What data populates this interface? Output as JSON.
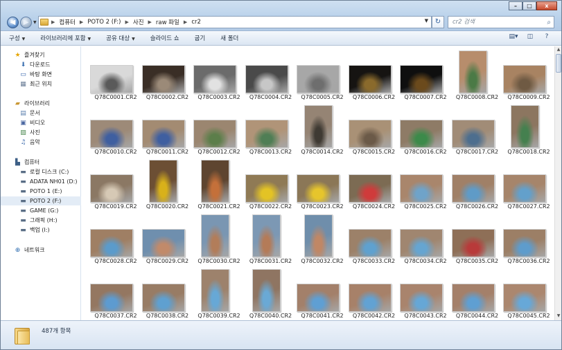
{
  "window": {
    "address_crumbs": [
      "컴퓨터",
      "POTO 2 (F:)",
      "사진",
      "raw 파일",
      "cr2"
    ],
    "search_placeholder": "cr2 검색",
    "min_label": "–",
    "max_label": "□",
    "close_label": "x"
  },
  "toolbar": {
    "items": [
      {
        "label": "구성",
        "dropdown": true
      },
      {
        "label": "라이브러리에 포함",
        "dropdown": true
      },
      {
        "label": "공유 대상",
        "dropdown": true
      },
      {
        "label": "슬라이드 쇼",
        "dropdown": false
      },
      {
        "label": "굽기",
        "dropdown": false
      },
      {
        "label": "새 폴더",
        "dropdown": false
      }
    ]
  },
  "sidebar": {
    "favorites_header": "즐겨찾기",
    "favorites": [
      "다운로드",
      "바탕 화면",
      "최근 위치"
    ],
    "libraries_header": "라이브러리",
    "libraries": [
      "문서",
      "비디오",
      "사진",
      "음악"
    ],
    "computer_header": "컴퓨터",
    "drives": [
      "로컬 디스크 (C:)",
      "ADATA NH01 (D:)",
      "POTO 1 (E:)",
      "POTO 2 (F:)",
      "GAME (G:)",
      "그래픽 (H:)",
      "백업 (I:)"
    ],
    "selected_drive": "POTO 2 (F:)",
    "network_header": "네트워크"
  },
  "files": [
    {
      "name": "Q78C0001.CR2",
      "tone": "#d9d9d9",
      "shade": "#5a5a5a",
      "portrait": false
    },
    {
      "name": "Q78C0002.CR2",
      "tone": "#3a2e26",
      "shade": "#9b8a78",
      "portrait": false
    },
    {
      "name": "Q78C0003.CR2",
      "tone": "#6b6b6b",
      "shade": "#e2e2e2",
      "portrait": false
    },
    {
      "name": "Q78C0004.CR2",
      "tone": "#4a4a4a",
      "shade": "#c7c7c7",
      "portrait": false
    },
    {
      "name": "Q78C0005.CR2",
      "tone": "#a7a7a7",
      "shade": "#6e6e6e",
      "portrait": false
    },
    {
      "name": "Q78C0006.CR2",
      "tone": "#161412",
      "shade": "#8a6a2c",
      "portrait": false
    },
    {
      "name": "Q78C0007.CR2",
      "tone": "#0f0f0f",
      "shade": "#6b4a1c",
      "portrait": false
    },
    {
      "name": "Q78C0008.CR2",
      "tone": "#b78d6c",
      "shade": "#4b7a46",
      "portrait": true
    },
    {
      "name": "Q78C0009.CR2",
      "tone": "#a88362",
      "shade": "#6f5a43",
      "portrait": false
    },
    {
      "name": "Q78C0010.CR2",
      "tone": "#9d8a78",
      "shade": "#3f5fa0",
      "portrait": false
    },
    {
      "name": "Q78C0011.CR2",
      "tone": "#a38b72",
      "shade": "#3f5fa0",
      "portrait": false
    },
    {
      "name": "Q78C0012.CR2",
      "tone": "#9b8670",
      "shade": "#5c7e4a",
      "portrait": false
    },
    {
      "name": "Q78C0013.CR2",
      "tone": "#b09478",
      "shade": "#4f7e55",
      "portrait": false
    },
    {
      "name": "Q78C0014.CR2",
      "tone": "#958474",
      "shade": "#3f3a33",
      "portrait": true
    },
    {
      "name": "Q78C0015.CR2",
      "tone": "#a99176",
      "shade": "#6b5a48",
      "portrait": false
    },
    {
      "name": "Q78C0016.CR2",
      "tone": "#8e7b66",
      "shade": "#3c8a4a",
      "portrait": false
    },
    {
      "name": "Q78C0017.CR2",
      "tone": "#a18c77",
      "shade": "#4d6e8e",
      "portrait": false
    },
    {
      "name": "Q78C0018.CR2",
      "tone": "#8c7660",
      "shade": "#45804f",
      "portrait": true
    },
    {
      "name": "Q78C0019.CR2",
      "tone": "#8b7864",
      "shade": "#d6c9b5",
      "portrait": false
    },
    {
      "name": "Q78C0020.CR2",
      "tone": "#6c4f34",
      "shade": "#d8b11a",
      "portrait": true
    },
    {
      "name": "Q78C0021.CR2",
      "tone": "#5e4530",
      "shade": "#c4703a",
      "portrait": true
    },
    {
      "name": "Q78C0022.CR2",
      "tone": "#8f7a55",
      "shade": "#e3c325",
      "portrait": false
    },
    {
      "name": "Q78C0023.CR2",
      "tone": "#8b7757",
      "shade": "#e6c52c",
      "portrait": false
    },
    {
      "name": "Q78C0024.CR2",
      "tone": "#7c6b53",
      "shade": "#cf3b3b",
      "portrait": false
    },
    {
      "name": "Q78C0025.CR2",
      "tone": "#a9866c",
      "shade": "#6fa3c9",
      "portrait": false
    },
    {
      "name": "Q78C0026.CR2",
      "tone": "#a08067",
      "shade": "#5f9bc7",
      "portrait": false
    },
    {
      "name": "Q78C0027.CR2",
      "tone": "#a6856b",
      "shade": "#63a0cb",
      "portrait": false
    },
    {
      "name": "Q78C0028.CR2",
      "tone": "#9f7f64",
      "shade": "#5b9bcb",
      "portrait": false
    },
    {
      "name": "Q78C0029.CR2",
      "tone": "#6f8fae",
      "shade": "#c18a6a",
      "portrait": false
    },
    {
      "name": "Q78C0030.CR2",
      "tone": "#7a96b2",
      "shade": "#b27d5a",
      "portrait": true
    },
    {
      "name": "Q78C0031.CR2",
      "tone": "#7c98b4",
      "shade": "#b47b58",
      "portrait": true
    },
    {
      "name": "Q78C0032.CR2",
      "tone": "#6f8eab",
      "shade": "#c08765",
      "portrait": true
    },
    {
      "name": "Q78C0033.CR2",
      "tone": "#9c8169",
      "shade": "#5fa1cf",
      "portrait": false
    },
    {
      "name": "Q78C0034.CR2",
      "tone": "#a08670",
      "shade": "#66a5d1",
      "portrait": false
    },
    {
      "name": "Q78C0035.CR2",
      "tone": "#8e6f57",
      "shade": "#b83a3a",
      "portrait": false
    },
    {
      "name": "Q78C0036.CR2",
      "tone": "#9c7f66",
      "shade": "#5e9ccc",
      "portrait": false
    },
    {
      "name": "Q78C0037.CR2",
      "tone": "#947761",
      "shade": "#5d9bd0",
      "portrait": false
    },
    {
      "name": "Q78C0038.CR2",
      "tone": "#987c65",
      "shade": "#5fa0d0",
      "portrait": false
    },
    {
      "name": "Q78C0039.CR2",
      "tone": "#9d826c",
      "shade": "#67a8d6",
      "portrait": true
    },
    {
      "name": "Q78C0040.CR2",
      "tone": "#8f7562",
      "shade": "#6aa9d5",
      "portrait": true
    },
    {
      "name": "Q78C0041.CR2",
      "tone": "#a3806a",
      "shade": "#5f9fd3",
      "portrait": false
    },
    {
      "name": "Q78C0042.CR2",
      "tone": "#a78169",
      "shade": "#62a2d3",
      "portrait": false
    },
    {
      "name": "Q78C0043.CR2",
      "tone": "#a9846d",
      "shade": "#66a7d6",
      "portrait": false
    },
    {
      "name": "Q78C0044.CR2",
      "tone": "#a4806a",
      "shade": "#5f9fd2",
      "portrait": false
    },
    {
      "name": "Q78C0045.CR2",
      "tone": "#ab876f",
      "shade": "#67a8d8",
      "portrait": false
    }
  ],
  "details": {
    "item_count": "487개 항목"
  }
}
